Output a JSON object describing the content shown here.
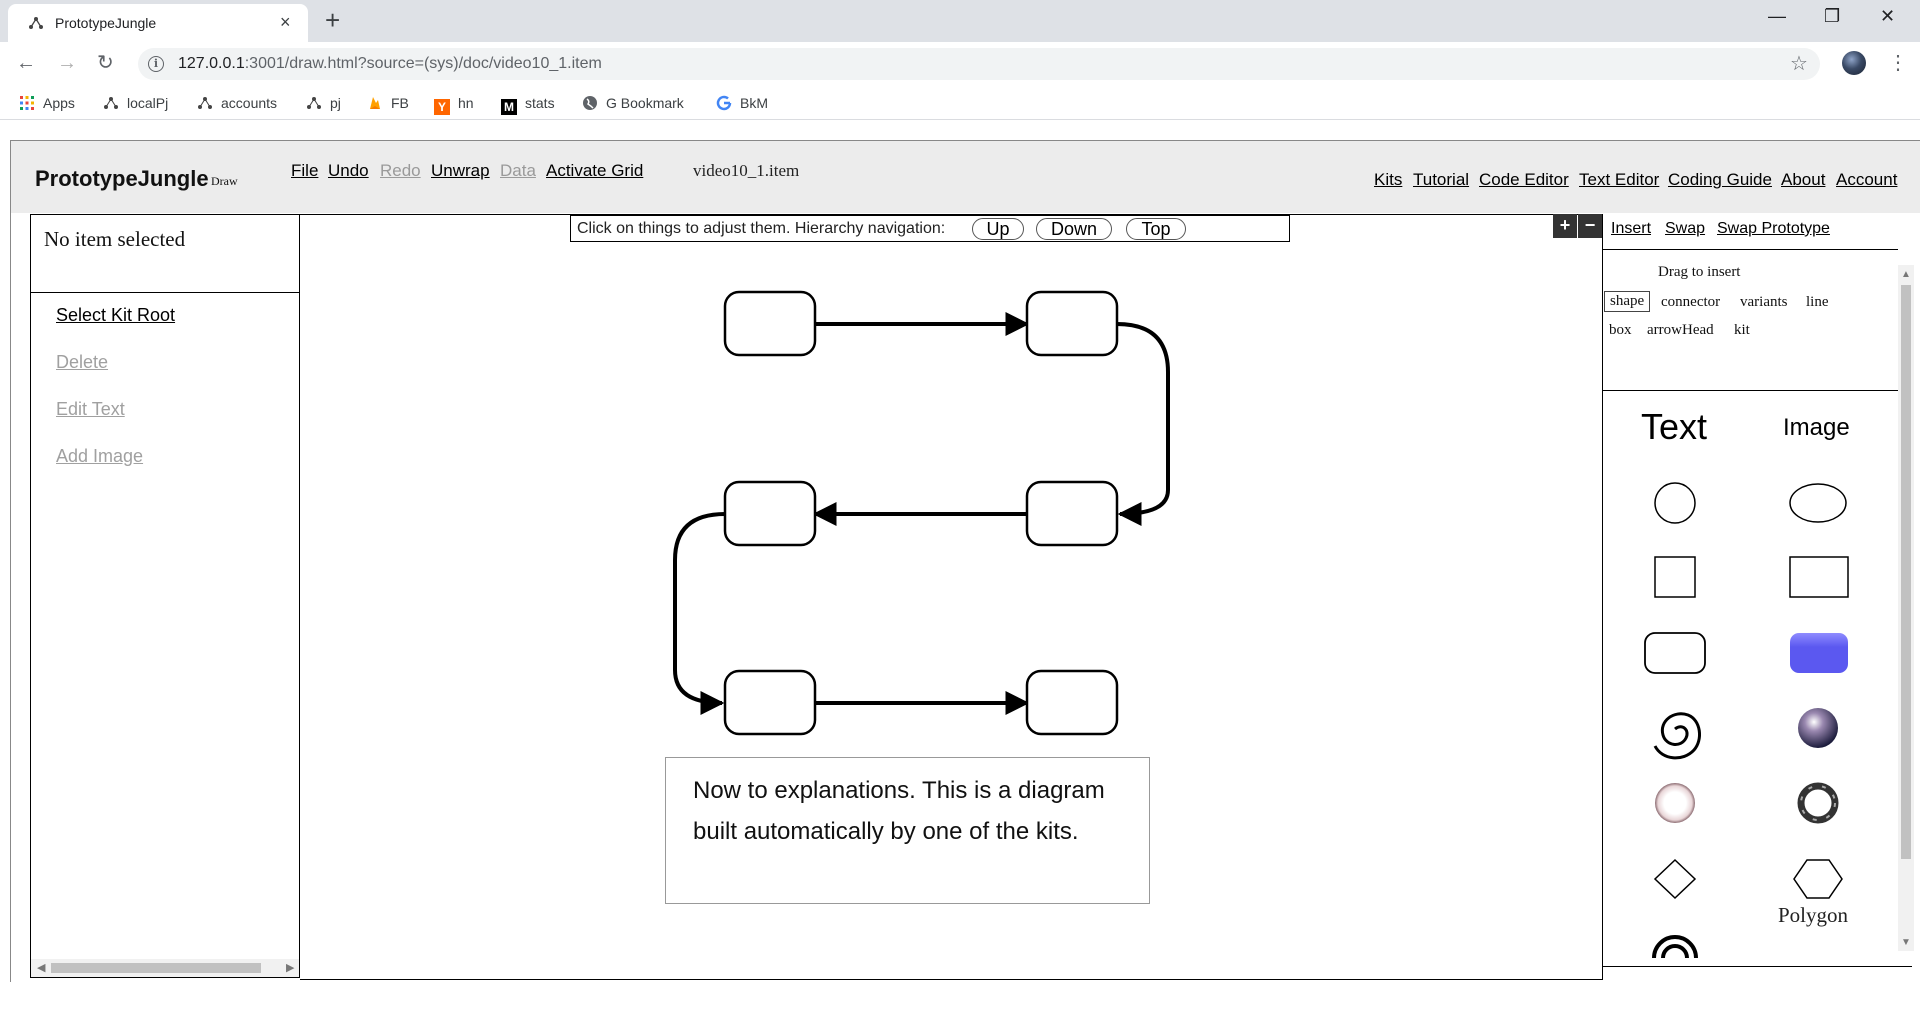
{
  "browser": {
    "tab_title": "PrototypeJungle",
    "tab_close": "×",
    "new_tab": "+",
    "window_controls": [
      "—",
      "❐",
      "✕"
    ],
    "url_host": "127.0.0.1",
    "url_rest": ":3001/draw.html?source=(sys)/doc/video10_1.item",
    "bookmarks": [
      "Apps",
      "localPj",
      "accounts",
      "pj",
      "FB",
      "hn",
      "stats",
      "G Bookmark",
      "BkM"
    ]
  },
  "app": {
    "brand": "PrototypeJungle",
    "brand_sub": "Draw",
    "menu": {
      "file": "File",
      "undo": "Undo",
      "redo": "Redo",
      "unwrap": "Unwrap",
      "data": "Data",
      "activate_grid": "Activate Grid"
    },
    "doc_name": "video10_1.item",
    "right_menu": [
      "Kits",
      "Tutorial",
      "Code Editor",
      "Text Editor",
      "Coding Guide",
      "About",
      "Account"
    ]
  },
  "left_panel": {
    "selection": "No item selected",
    "actions": {
      "select_kit_root": "Select Kit Root",
      "delete": "Delete",
      "edit_text": "Edit Text",
      "add_image": "Add Image"
    }
  },
  "canvas": {
    "hint": "Click on things to adjust them. Hierarchy navigation:",
    "nav": {
      "up": "Up",
      "down": "Down",
      "top": "Top"
    },
    "note": "Now to explanations. This is a diagram built automatically by one of the kits."
  },
  "right_panel": {
    "zoom_in": "+",
    "zoom_out": "−",
    "tabs": {
      "insert": "Insert",
      "swap": "Swap",
      "swap_prototype": "Swap Prototype"
    },
    "drag_label": "Drag to insert",
    "categories": [
      "shape",
      "connector",
      "variants",
      "line",
      "box",
      "arrowHead",
      "kit"
    ],
    "active_category": "shape",
    "palette": {
      "text": "Text",
      "image": "Image",
      "polygon": "Polygon"
    }
  }
}
